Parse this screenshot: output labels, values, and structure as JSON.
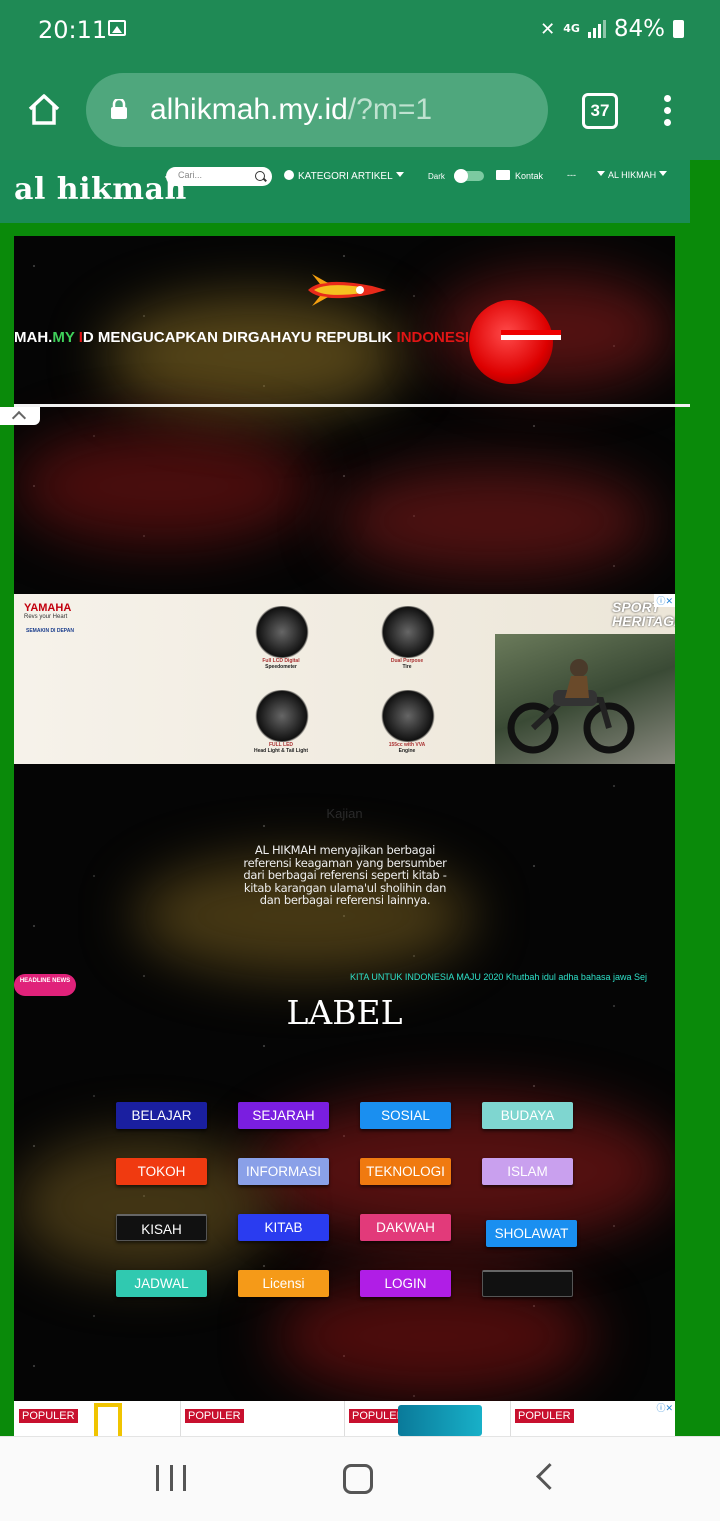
{
  "status": {
    "time": "20:11",
    "network": "4G",
    "battery": "84%"
  },
  "browser": {
    "url_host": "alhikmah.my.id",
    "url_path": "/?m=1",
    "tab_count": "37"
  },
  "site": {
    "logo": "al hikmah",
    "search_placeholder": "Cari...",
    "nav": {
      "kategori": "KATEGORI ARTIKEL",
      "dark": "Dark",
      "kontak": "Kontak",
      "dash": "---",
      "alhikmah": "AL HIKMAH"
    }
  },
  "banner": {
    "part1": "MAH.",
    "part2": "MY",
    "part3": " I",
    "part4": "D MENGUCAPKAN DIRGAHAYU REPUBLIK ",
    "part5": "INDONESI"
  },
  "ad": {
    "brand": "YAMAHA",
    "brand_sub": "Revs your Heart",
    "tagline": "SEMAKIN DI DEPAN",
    "headline": "SPORT HERITAGE",
    "features": [
      {
        "label": "Full LCD Digital",
        "sub": "Speedometer"
      },
      {
        "label": "Dual Purpose",
        "sub": "Tire"
      },
      {
        "label": "FULL LED",
        "sub": "Head Light & Tail Light"
      },
      {
        "label": "155cc with VVA",
        "sub": "Engine"
      }
    ]
  },
  "content": {
    "kajian": "Kajian",
    "intro": "AL HIKMAH menyajikan berbagai referensi keagaman yang bersumber dari berbagai referensi seperti kitab - kitab karangan ulama'ul sholihin dan dan berbagai referensi lainnya.",
    "headline_badge": "HEADLINE NEWS",
    "ticker": "KITA UNTUK INDONESIA MAJU 2020   Khutbah idul adha bahasa jawa   Sej",
    "label_title": "LABEL"
  },
  "labels": [
    {
      "text": "BELAJAR",
      "color": "#1a1fa0"
    },
    {
      "text": "SEJARAH",
      "color": "#7a1ee0"
    },
    {
      "text": "SOSIAL",
      "color": "#1a8ff0"
    },
    {
      "text": "BUDAYA",
      "color": "#7fd6d0"
    },
    {
      "text": "TOKOH",
      "color": "#f03a10"
    },
    {
      "text": "INFORMASI",
      "color": "#8aa0e8"
    },
    {
      "text": "TEKNOLOGI",
      "color": "#f07a10"
    },
    {
      "text": "ISLAM",
      "color": "#c9a0ee"
    },
    {
      "text": "KISAH",
      "color": "#111111"
    },
    {
      "text": "KITAB",
      "color": "#2a3cf0"
    },
    {
      "text": "DAKWAH",
      "color": "#e23a7a"
    },
    {
      "text": "SHOLAWAT",
      "color": "#1a8ff0"
    },
    {
      "text": "JADWAL",
      "color": "#30c9b0"
    },
    {
      "text": "Licensi",
      "color": "#f59a18"
    },
    {
      "text": "LOGIN",
      "color": "#b01ee6"
    },
    {
      "text": "",
      "color": "#111111"
    }
  ],
  "populer": [
    "POPULER",
    "POPULER",
    "POPULER",
    "POPULER"
  ]
}
